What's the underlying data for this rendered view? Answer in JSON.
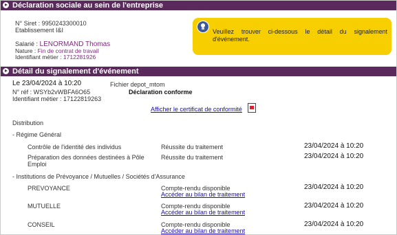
{
  "section1": {
    "title": "Déclaration sociale au sein de l'entreprise",
    "siret_label": "N° Siret : ",
    "siret_value": "9950243300010",
    "establishment": "Etablissement I&I",
    "salarie_label": "Salarié : ",
    "salarie_value": "LENORMAND Thomas",
    "nature_label": "Nature : ",
    "nature_value": "Fin de contrat de travail",
    "identifiant_label": "Identifiant métier : ",
    "identifiant_value": "1712281926",
    "info_text": "Veuillez trouver ci-dessous le détail du signalement d'événement."
  },
  "section2": {
    "title": "Détail du signalement d'événement",
    "le_label": "Le ",
    "le_value": "23/04/2024 à 10:20",
    "fichier": "Fichier depot_mtom",
    "ref_label": "N° réf : ",
    "ref_value": "WSYb2vWBFA6O65",
    "conformity": "Déclaration conforme",
    "identifiant": "Identifiant métier : 17122819263",
    "certificate_link": "Afficher le certificat de conformité",
    "distribution": "Distribution",
    "regime_general": "- Régime Général",
    "controle": "Contrôle de l'identité des individus",
    "controle_status": "Réussite du traitement",
    "controle_date": "23/04/2024 à 10:20",
    "preparation_line1": "Préparation des données destinées à Pôle",
    "preparation_line2": "Emploi",
    "preparation_status": "Réussite du traitement",
    "preparation_date": "23/04/2024 à 10:20",
    "institutions": "- Institutions de Prévoyance / Mutuelles / Sociétés d'Assurance",
    "prevoyance": "PREVOYANCE",
    "mutuelle": "MUTUELLE",
    "conseil": "CONSEIL",
    "compte_rendu": "Compte-rendu disponible",
    "bilan_link": "Accéder au bilan de traitement",
    "prevoyance_date": "23/04/2024 à 10:20",
    "mutuelle_date": "23/04/2024 à 10:20",
    "conseil_date": "23/04/2024 à 10:20"
  }
}
